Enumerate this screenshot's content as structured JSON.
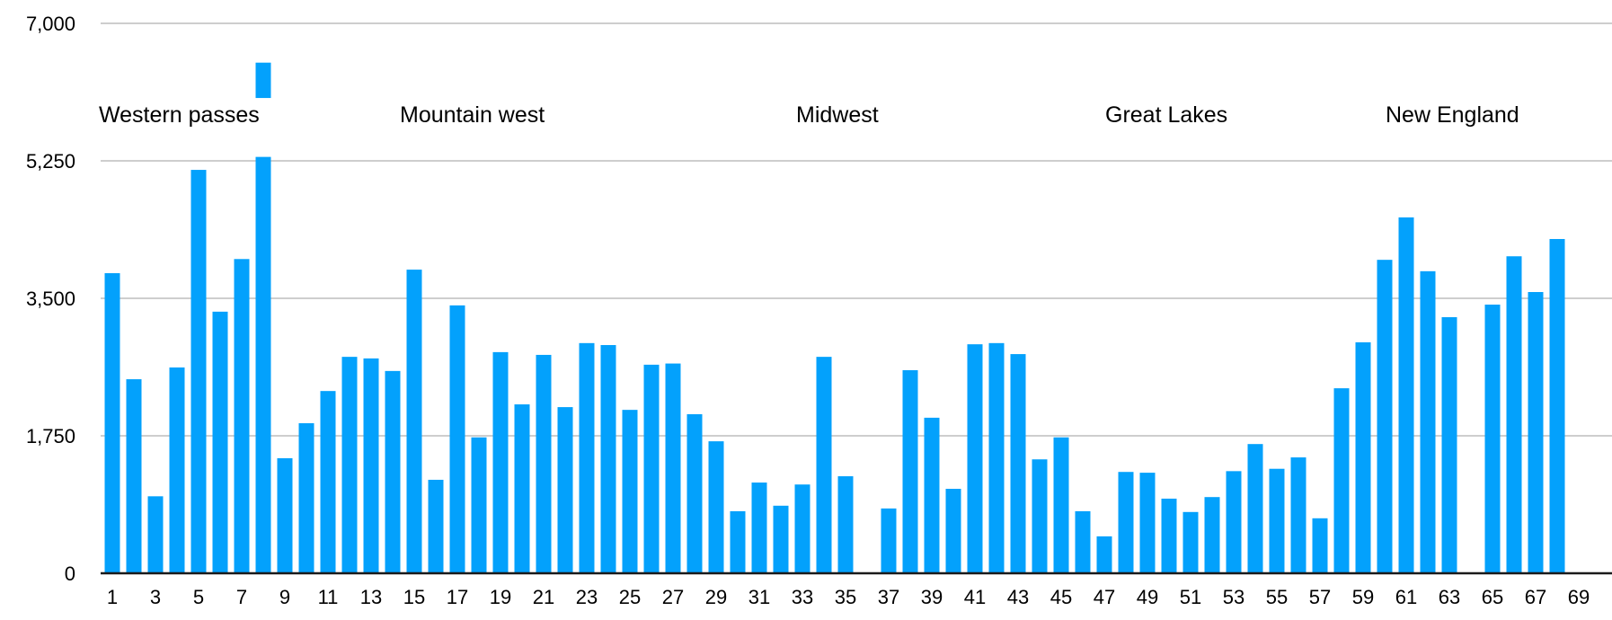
{
  "chart_data": {
    "type": "bar",
    "title": "",
    "xlabel": "",
    "ylabel": "",
    "ylim": [
      0,
      7000
    ],
    "yticks": [
      0,
      1750,
      3500,
      5250,
      7000
    ],
    "ytick_labels": [
      "0",
      "1,750",
      "3,500",
      "5,250",
      "7,000"
    ],
    "xtick_labels": [
      "1",
      "3",
      "5",
      "7",
      "9",
      "11",
      "13",
      "15",
      "17",
      "19",
      "21",
      "23",
      "25",
      "27",
      "29",
      "31",
      "33",
      "35",
      "37",
      "39",
      "41",
      "43",
      "45",
      "47",
      "49",
      "51",
      "53",
      "55",
      "57",
      "59",
      "61",
      "63",
      "65",
      "67",
      "69"
    ],
    "grid": true,
    "bar_color": "#03a1fc",
    "categories": [
      1,
      2,
      3,
      4,
      5,
      6,
      7,
      8,
      9,
      10,
      11,
      12,
      13,
      14,
      15,
      16,
      17,
      18,
      19,
      20,
      21,
      22,
      23,
      24,
      25,
      26,
      27,
      28,
      29,
      30,
      31,
      32,
      33,
      34,
      35,
      36,
      37,
      38,
      39,
      40,
      41,
      42,
      43,
      44,
      45,
      46,
      47,
      48,
      49,
      50,
      51,
      52,
      53,
      54,
      55,
      56,
      57,
      58,
      59,
      60,
      61,
      62,
      63,
      64,
      65,
      66,
      67,
      68,
      69
    ],
    "values": [
      3820,
      2470,
      980,
      2620,
      5135,
      3330,
      4000,
      6500,
      1465,
      1910,
      2320,
      2755,
      2735,
      2575,
      3865,
      1190,
      3410,
      1730,
      2815,
      2150,
      2780,
      2115,
      2930,
      2905,
      2080,
      2655,
      2670,
      2025,
      1680,
      790,
      1155,
      860,
      1130,
      2755,
      1235,
      0,
      825,
      2585,
      1980,
      1075,
      2915,
      2930,
      2790,
      1450,
      1730,
      790,
      470,
      1290,
      1280,
      950,
      780,
      970,
      1300,
      1645,
      1330,
      1475,
      700,
      2355,
      2940,
      3990,
      4530,
      3845,
      3260,
      0,
      3420,
      4035,
      3580,
      4255,
      0
    ],
    "axis_break": {
      "category": 8,
      "note": "bar drawn with a break between ~5,300 and ~6,100"
    },
    "annotations": [
      {
        "text": "Western passes",
        "category_start": 1
      },
      {
        "text": "Mountain west",
        "category_start": 14
      },
      {
        "text": "Midwest",
        "category_start": 32
      },
      {
        "text": "Great Lakes",
        "category_start": 46
      },
      {
        "text": "New England",
        "category_start": 59
      }
    ]
  }
}
